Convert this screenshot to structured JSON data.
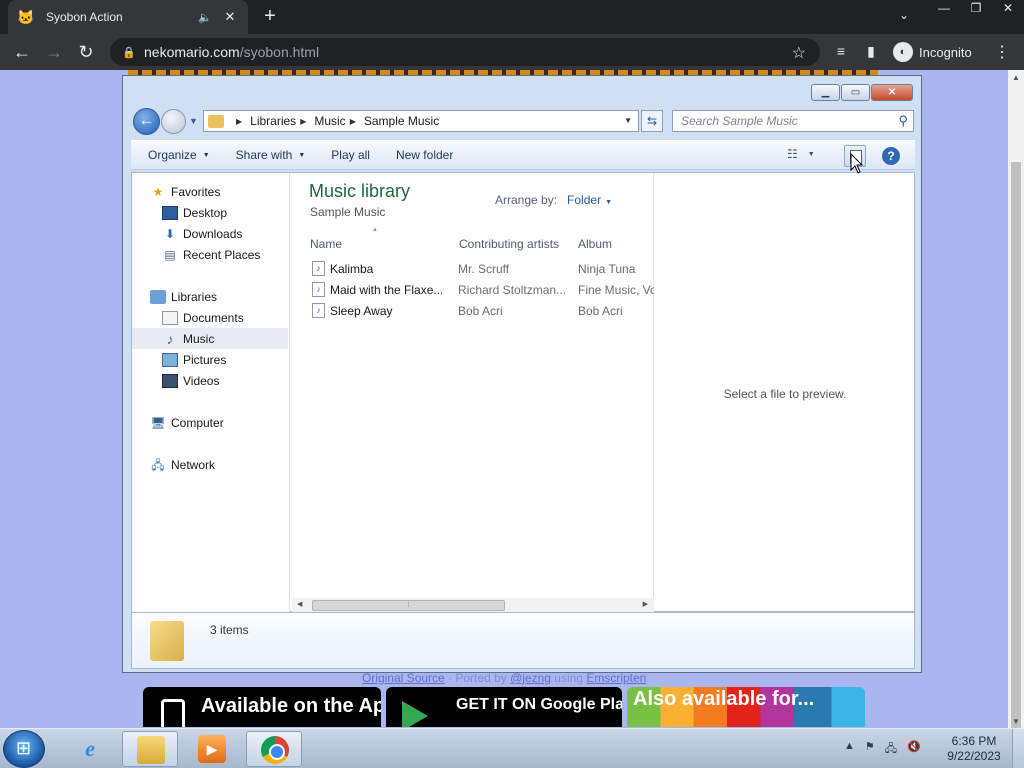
{
  "browser": {
    "tab_title": "Syobon Action",
    "url_host": "nekomario.com",
    "url_path": "/syobon.html",
    "incognito_label": "Incognito"
  },
  "page": {
    "links": {
      "original_source": "Original Source",
      "sep1": " · Ported by ",
      "author": "@jezng",
      "sep2": " using ",
      "tool": "Emscripten"
    },
    "store_apple": "Available on the App Store",
    "store_google": "GET IT ON Google Play",
    "store_also": "Also available for..."
  },
  "explorer": {
    "breadcrumb": [
      "Libraries",
      "Music",
      "Sample Music"
    ],
    "search_placeholder": "Search Sample Music",
    "commands": [
      "Organize",
      "Share with",
      "Play all",
      "New folder"
    ],
    "nav": {
      "favorites": "Favorites",
      "favorites_items": [
        "Desktop",
        "Downloads",
        "Recent Places"
      ],
      "libraries": "Libraries",
      "libraries_items": [
        "Documents",
        "Music",
        "Pictures",
        "Videos"
      ],
      "computer": "Computer",
      "network": "Network",
      "selected": "Music"
    },
    "library_title": "Music library",
    "library_sub": "Sample Music",
    "arrange_label": "Arrange by:",
    "arrange_value": "Folder",
    "columns": [
      "Name",
      "Contributing artists",
      "Album"
    ],
    "files": [
      {
        "name": "Kalimba",
        "artist": "Mr. Scruff",
        "album": "Ninja Tuna"
      },
      {
        "name": "Maid with the Flaxe...",
        "artist": "Richard Stoltzman...",
        "album": "Fine Music, Vo"
      },
      {
        "name": "Sleep Away",
        "artist": "Bob Acri",
        "album": "Bob Acri"
      }
    ],
    "preview_msg": "Select a file to preview.",
    "item_count": "3 items"
  },
  "taskbar": {
    "time": "6:36 PM",
    "date": "9/22/2023"
  },
  "colors": {
    "accent": "#1e6a38",
    "browser_bg": "#35363a",
    "page_bg": "#a9b6f0"
  }
}
